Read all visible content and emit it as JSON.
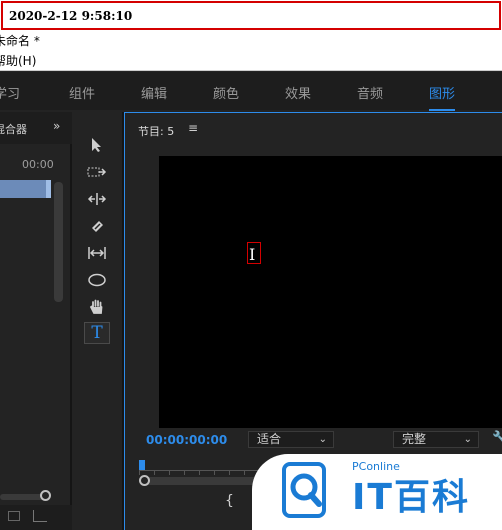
{
  "timestamp": "2020-2-12 9:58:10",
  "project_name": "未命名 *",
  "help_menu": "帮助(H)",
  "workspaces": [
    {
      "label": "学习",
      "active": false
    },
    {
      "label": "组件",
      "active": false
    },
    {
      "label": "编辑",
      "active": false
    },
    {
      "label": "颜色",
      "active": false
    },
    {
      "label": "效果",
      "active": false
    },
    {
      "label": "音频",
      "active": false
    },
    {
      "label": "图形",
      "active": true
    }
  ],
  "left_panel": {
    "title": "混合器",
    "more": "»",
    "timecode": "00:00"
  },
  "tools": [
    {
      "icon": "selection-arrow-icon"
    },
    {
      "icon": "track-select-icon"
    },
    {
      "icon": "ripple-edit-icon"
    },
    {
      "icon": "razor-icon"
    },
    {
      "icon": "slip-icon"
    },
    {
      "icon": "ellipse-icon"
    },
    {
      "icon": "hand-icon"
    },
    {
      "icon": "type-tool-icon",
      "label": "T",
      "active": true
    }
  ],
  "monitor": {
    "title": "节目: 5",
    "menu_icon": "≡",
    "timecode": "00:00:00:00",
    "zoom": "适合",
    "quality": "完整",
    "caret": "⌄",
    "wrench": "🔧",
    "brace": "{"
  },
  "watermark": {
    "brand_small": "PConline",
    "brand_title": "IT百科"
  },
  "colors": {
    "accent": "#2d8ceb",
    "highlight": "#d40000",
    "panel": "#232323"
  }
}
